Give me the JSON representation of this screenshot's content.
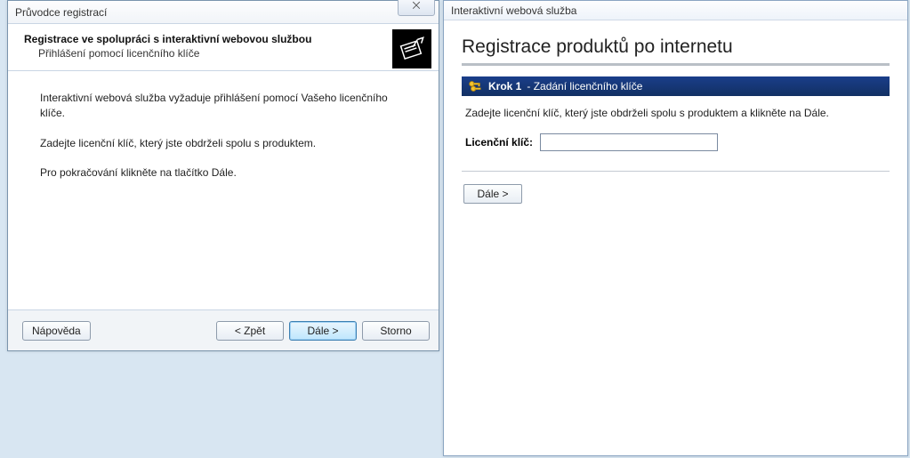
{
  "wizard": {
    "title": "Průvodce registrací",
    "close_glyph": "⨉",
    "heading": "Registrace ve spolupráci s interaktivní webovou službou",
    "subheading": "Přihlášení pomocí licenčního klíče",
    "para1": "Interaktivní webová služba vyžaduje přihlášení pomocí Vašeho licenčního klíče.",
    "para2": "Zadejte licenční klíč, který jste obdrželi spolu s produktem.",
    "para3": "Pro pokračování klikněte na tlačítko Dále.",
    "buttons": {
      "help": "Nápověda",
      "back": "< Zpět",
      "next": "Dále >",
      "cancel": "Storno"
    }
  },
  "web": {
    "title": "Interaktivní webová služba",
    "page_heading": "Registrace produktů po internetu",
    "step": {
      "name": "Krok 1",
      "desc": "Zadání licenčního klíče"
    },
    "instruction": "Zadejte licenční klíč, který jste obdrželi spolu s produktem a klikněte na Dále.",
    "field_label": "Licenční klíč:",
    "field_value": "",
    "next": "Dále >"
  }
}
